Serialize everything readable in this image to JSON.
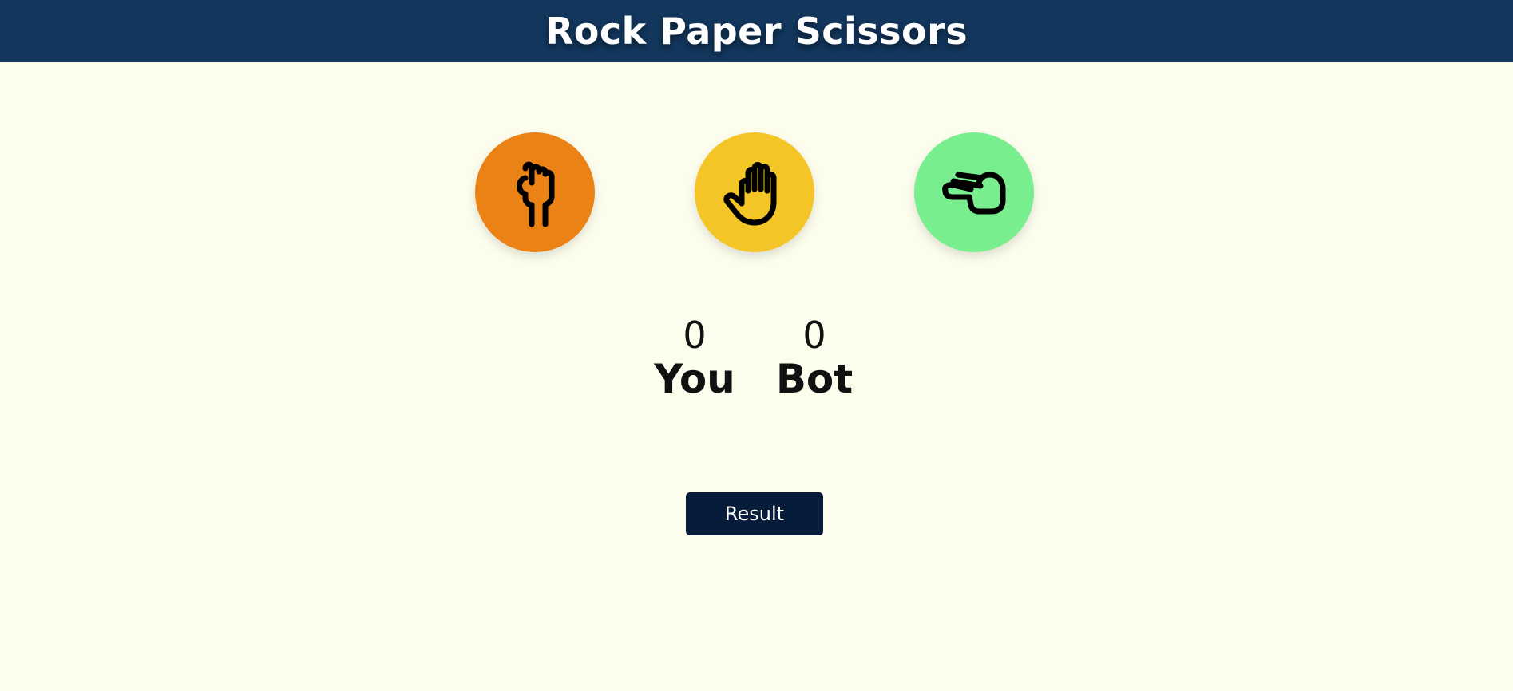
{
  "header": {
    "title": "Rock Paper Scissors"
  },
  "choices": [
    {
      "id": "rock",
      "icon": "rock-fist-icon",
      "color": "#eb8216"
    },
    {
      "id": "paper",
      "icon": "paper-hand-icon",
      "color": "#f4c526"
    },
    {
      "id": "scissors",
      "icon": "scissors-hand-icon",
      "color": "#78ee8f"
    }
  ],
  "scoreboard": {
    "you": {
      "score": "0",
      "label": "You"
    },
    "bot": {
      "score": "0",
      "label": "Bot"
    }
  },
  "result_button": {
    "label": "Result"
  },
  "colors": {
    "header_bg": "#12365c",
    "page_bg": "#fdfdee",
    "button_bg": "#061c3a"
  }
}
